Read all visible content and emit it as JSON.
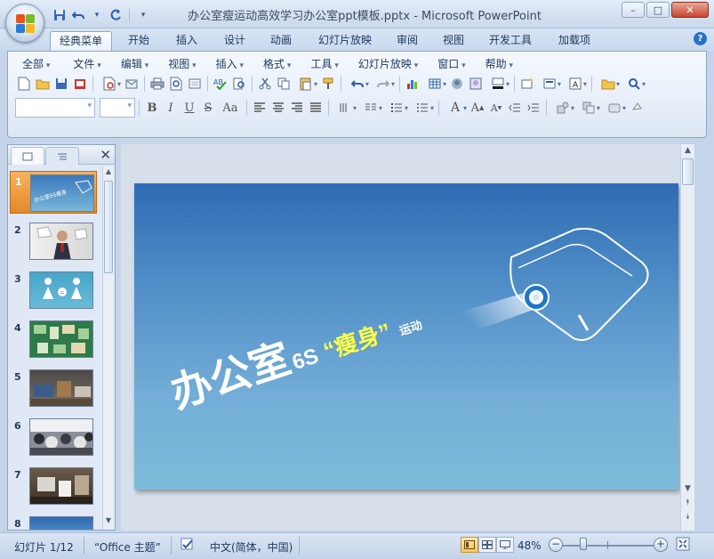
{
  "window": {
    "title": "办公室瘦运动高效学习办公室ppt模板.pptx - Microsoft PowerPoint",
    "controls": {
      "minimize": "–",
      "maximize": "□",
      "close": "✕"
    }
  },
  "qat": {
    "customize": "▾"
  },
  "ribbon": {
    "tabs": [
      "经典菜单",
      "开始",
      "插入",
      "设计",
      "动画",
      "幻灯片放映",
      "审阅",
      "视图",
      "开发工具",
      "加载项"
    ],
    "active_tab": "经典菜单",
    "help": "?",
    "menus": [
      "全部",
      "文件",
      "编辑",
      "视图",
      "插入",
      "格式",
      "工具",
      "幻灯片放映",
      "窗口",
      "帮助"
    ],
    "format_buttons": {
      "bold": "B",
      "italic": "I",
      "underline": "U",
      "strike": "S",
      "case": "Aa"
    }
  },
  "slide_panel": {
    "tab_slides_icon": "slides-tab-icon",
    "tab_outline_icon": "outline-tab-icon",
    "close": "✕",
    "thumbnails": [
      {
        "num": "1",
        "selected": true,
        "label": "办公室6S瘦身"
      },
      {
        "num": "2",
        "selected": false,
        "label": ""
      },
      {
        "num": "3",
        "selected": false,
        "label": ""
      },
      {
        "num": "4",
        "selected": false,
        "label": ""
      },
      {
        "num": "5",
        "selected": false,
        "label": ""
      },
      {
        "num": "6",
        "selected": false,
        "label": ""
      },
      {
        "num": "7",
        "selected": false,
        "label": ""
      },
      {
        "num": "8",
        "selected": false,
        "label": ""
      }
    ]
  },
  "slide": {
    "title_main": "办公室",
    "title_6s": "6S",
    "title_quote": "“瘦身”",
    "title_sub": "运动"
  },
  "status": {
    "slide_info": "幻灯片 1/12",
    "theme": "“Office 主题”",
    "language": "中文(简体，中国)",
    "zoom": "48%",
    "zoom_minus": "−",
    "zoom_plus": "+"
  },
  "colors": {
    "slide_top": "#2e6bb3",
    "slide_bottom": "#7cbcd9",
    "accent_yellow": "#ffff44",
    "selected_thumb": "#e28a2a"
  }
}
